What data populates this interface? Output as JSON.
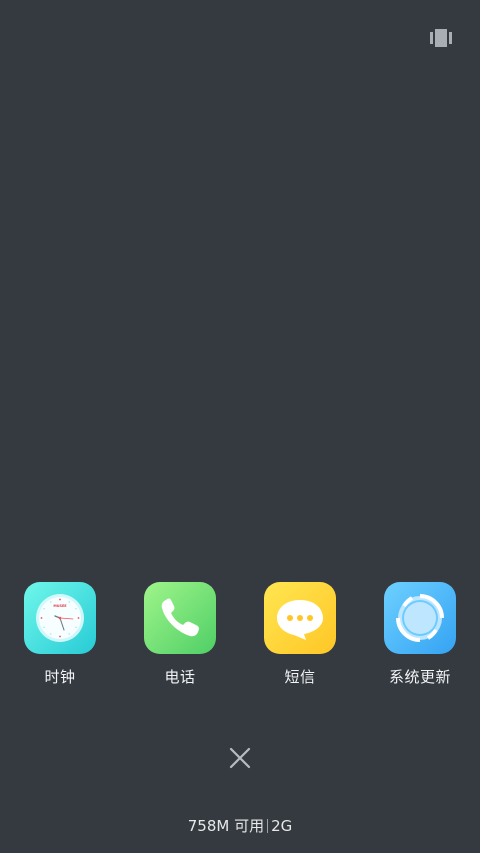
{
  "top_bar": {
    "view_toggle_icon": "multi-window-icon"
  },
  "apps": [
    {
      "label": "时钟",
      "icon": "clock-icon",
      "color_from": "#5ef3e6",
      "color_to": "#2ad0d8",
      "clock_brand": "MUSEE"
    },
    {
      "label": "电话",
      "icon": "phone-icon",
      "color_from": "#8df27e",
      "color_to": "#56d36a"
    },
    {
      "label": "短信",
      "icon": "message-icon",
      "color_from": "#ffe14a",
      "color_to": "#ffc92a"
    },
    {
      "label": "系统更新",
      "icon": "system-update-icon",
      "color_from": "#5cc9ff",
      "color_to": "#3aa8f5"
    }
  ],
  "bottom": {
    "close_icon": "close-icon",
    "memory_available": "758M 可用",
    "memory_total": "2G"
  }
}
